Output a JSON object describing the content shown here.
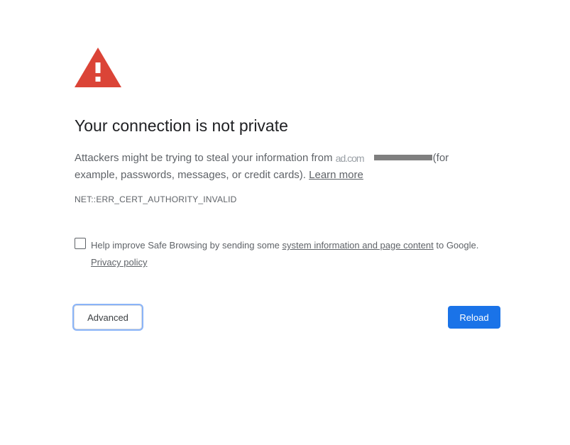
{
  "interstitial": {
    "icon": "warning-triangle-icon",
    "icon_color": "#db4437",
    "title": "Your connection is not private",
    "explanation_before": "Attackers might be trying to steal your information from",
    "redacted_host_fragment": "ad.com",
    "explanation_after": "(for example, passwords, messages, or credit cards).",
    "learn_more": "Learn more",
    "error_code": "NET::ERR_CERT_AUTHORITY_INVALID"
  },
  "safe_browsing": {
    "checked": false,
    "text_before": "Help improve Safe Browsing by sending some",
    "link_label": "system information and page content",
    "text_after": "to Google.",
    "privacy_policy": "Privacy policy"
  },
  "buttons": {
    "advanced_label": "Advanced",
    "reload_label": "Reload",
    "reload_color": "#1a73e8"
  }
}
